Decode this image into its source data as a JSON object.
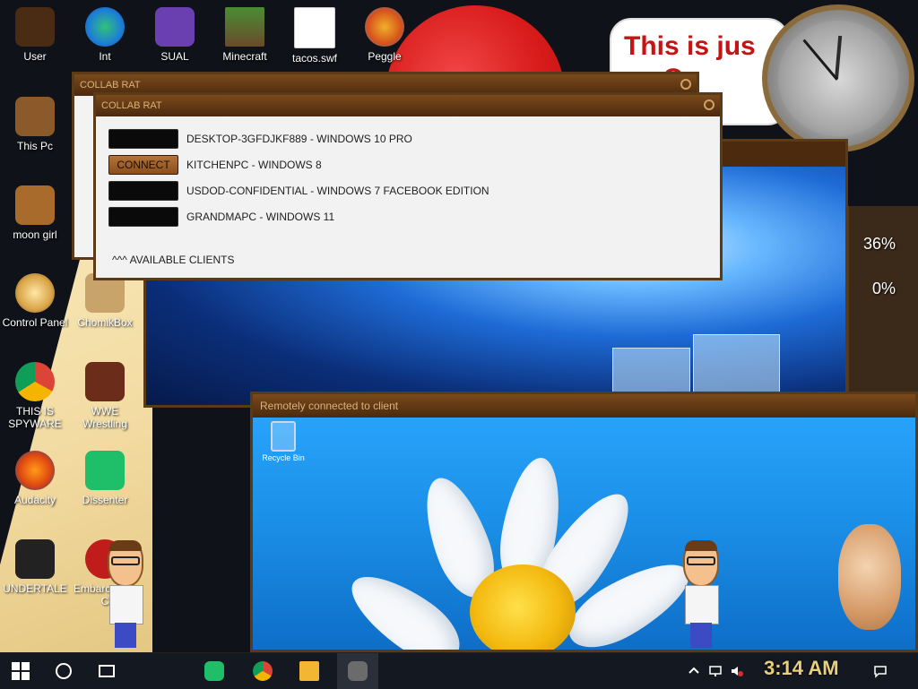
{
  "desktop": {
    "icons": [
      {
        "label": "User"
      },
      {
        "label": "Int"
      },
      {
        "label": "SUAL"
      },
      {
        "label": "Minecraft"
      },
      {
        "label": "tacos.swf"
      },
      {
        "label": "Peggle"
      },
      {
        "label": "This Pc"
      },
      {
        "label": "moon girl"
      },
      {
        "label": "Control Panel"
      },
      {
        "label": "ChomikBox"
      },
      {
        "label": "THIS IS SPYWARE"
      },
      {
        "label": "WWE Wrestling"
      },
      {
        "label": "Audacity"
      },
      {
        "label": "Dissenter"
      },
      {
        "label": "UNDERTALE"
      },
      {
        "label": "Embarc Dev-C"
      }
    ],
    "banner_text_line1": "This is jus",
    "banner_text_line2": "ge O",
    "side_percent_1": "36%",
    "side_percent_2": "0%"
  },
  "collab_window_back": {
    "title": "COLLAB RAT"
  },
  "collab_window": {
    "title": "COLLAB RAT",
    "clients": [
      {
        "button": "",
        "name": "DESKTOP-3GFDJKF889 - WINDOWS 10 PRO",
        "active": false
      },
      {
        "button": "CONNECT",
        "name": "KITCHENPC - WINDOWS 8",
        "active": true
      },
      {
        "button": "",
        "name": "USDOD-CONFIDENTIAL - WINDOWS 7 FACEBOOK EDITION",
        "active": false
      },
      {
        "button": "",
        "name": "GRANDMAPC - WINDOWS 11",
        "active": false
      }
    ],
    "footer": "^^^ AVAILABLE CLIENTS"
  },
  "remote_window": {
    "title": "Remotely connected to client",
    "recycle_bin_label": "Recycle Bin"
  },
  "taskbar": {
    "time": "3:14 AM",
    "pinned": [
      "start-icon",
      "cortana-icon",
      "task-view-icon",
      "dissenter-icon",
      "chrome-icon",
      "file-explorer-icon",
      "skull-app-icon"
    ],
    "tray": [
      "chevron-up-icon",
      "network-icon",
      "volume-muted-icon",
      "notification-icon"
    ]
  },
  "colors": {
    "steam_brown": "#5b3a17",
    "connect_button": "#b47538",
    "clock_text": "#e7cf7c"
  }
}
